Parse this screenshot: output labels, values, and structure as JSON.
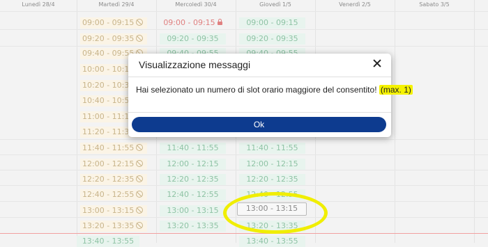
{
  "calendar": {
    "days": [
      {
        "label": "Lunedì 28/4"
      },
      {
        "label": "Martedì 29/4"
      },
      {
        "label": "Mercoledì 30/4"
      },
      {
        "label": "Giovedì 1/5"
      },
      {
        "label": "Venerdì 2/5"
      },
      {
        "label": "Sabato 3/5"
      }
    ],
    "tuesday_slots": [
      "09:00 - 09:15",
      "09:20 - 09:35",
      "09:40 - 09:55",
      "10:00 - 10:15",
      "10:20 - 10:35",
      "10:40 - 10:55",
      "11:00 - 11:15",
      "11:20 - 11:35",
      "11:40 - 11:55",
      "12:00 - 12:15",
      "12:20 - 12:35",
      "12:40 - 12:55",
      "13:00 - 13:15",
      "13:20 - 13:35",
      "13:40 - 13:55"
    ],
    "wednesday_slots": [
      "09:00 - 09:15",
      "09:20 - 09:35",
      "09:40 - 09:55",
      "11:40 - 11:55",
      "12:00 - 12:15",
      "12:20 - 12:35",
      "12:40 - 12:55",
      "13:00 - 13:15",
      "13:20 - 13:35"
    ],
    "thursday_slots": [
      "09:00 - 09:15",
      "09:20 - 09:35",
      "09:40 - 09:55",
      "11:40 - 11:55",
      "12:00 - 12:15",
      "12:20 - 12:35",
      "12:40 - 12:55",
      "13:00 - 13:15",
      "13:20 - 13:35",
      "13:40 - 13:55"
    ]
  },
  "modal": {
    "title": "Visualizzazione messaggi",
    "message": "Hai selezionato un numero di slot orario maggiore del consentito!",
    "message_max": "(max. 1)",
    "ok_label": "Ok"
  },
  "colors": {
    "ok_button": "#0d3b8f",
    "highlight": "#f5f200",
    "locked_slot": "#e08080",
    "available_slot": "#e8f4ee"
  }
}
